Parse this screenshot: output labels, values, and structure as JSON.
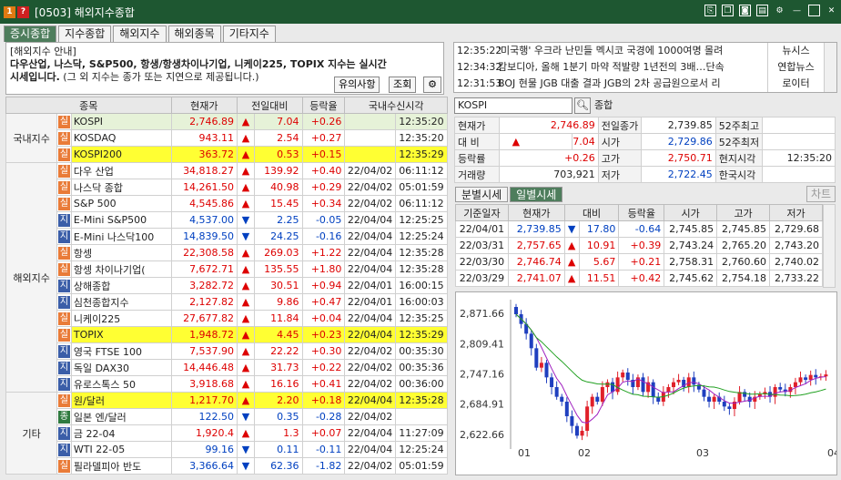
{
  "window": {
    "badge1": "1",
    "badge2": "?",
    "title": "[0503] 해외지수종합"
  },
  "tabs": [
    "증시종합",
    "지수종합",
    "해외지수",
    "해외종목",
    "기타지수"
  ],
  "notice": {
    "line1": "[해외지수 안내]",
    "line2": "다우산업, 나스닥, S&P500, 항생/항생차이나기업, 니케이225, TOPIX 지수는 실시간",
    "line3a": "시세입니다.",
    "line3b": "(그 외 지수는 종가 또는 지연으로 제공됩니다.)",
    "btn_caution": "유의사항",
    "btn_query": "조회"
  },
  "list_headers": [
    "종목",
    "현재가",
    "전일대비",
    "등락율",
    "국내수신시각"
  ],
  "groups": [
    {
      "label": "국내지수",
      "rows": [
        {
          "tag": "실",
          "name": "KOSPI",
          "price": "2,746.89",
          "dir": "▲",
          "chg": "7.04",
          "rate": "+0.26",
          "date": "",
          "time": "12:35:20",
          "hl": "grn"
        },
        {
          "tag": "실",
          "name": "KOSDAQ",
          "price": "943.11",
          "dir": "▲",
          "chg": "2.54",
          "rate": "+0.27",
          "date": "",
          "time": "12:35:20",
          "hl": ""
        },
        {
          "tag": "실",
          "name": "KOSPI200",
          "price": "363.72",
          "dir": "▲",
          "chg": "0.53",
          "rate": "+0.15",
          "date": "",
          "time": "12:35:29",
          "hl": "yel"
        }
      ]
    },
    {
      "label": "해외지수",
      "rows": [
        {
          "tag": "실",
          "name": "다우 산업",
          "price": "34,818.27",
          "dir": "▲",
          "chg": "139.92",
          "rate": "+0.40",
          "date": "22/04/02",
          "time": "06:11:12",
          "hl": ""
        },
        {
          "tag": "실",
          "name": "나스닥 종합",
          "price": "14,261.50",
          "dir": "▲",
          "chg": "40.98",
          "rate": "+0.29",
          "date": "22/04/02",
          "time": "05:01:59",
          "hl": ""
        },
        {
          "tag": "실",
          "name": "S&P 500",
          "price": "4,545.86",
          "dir": "▲",
          "chg": "15.45",
          "rate": "+0.34",
          "date": "22/04/02",
          "time": "06:11:12",
          "hl": ""
        },
        {
          "tag": "지",
          "name": "E-Mini S&P500",
          "price": "4,537.00",
          "dir": "▼",
          "chg": "2.25",
          "rate": "-0.05",
          "date": "22/04/04",
          "time": "12:25:25",
          "hl": ""
        },
        {
          "tag": "지",
          "name": "E-Mini 나스닥100",
          "price": "14,839.50",
          "dir": "▼",
          "chg": "24.25",
          "rate": "-0.16",
          "date": "22/04/04",
          "time": "12:25:24",
          "hl": ""
        },
        {
          "tag": "실",
          "name": "항셍",
          "price": "22,308.58",
          "dir": "▲",
          "chg": "269.03",
          "rate": "+1.22",
          "date": "22/04/04",
          "time": "12:35:28",
          "hl": ""
        },
        {
          "tag": "실",
          "name": "항셍 차이나기업(",
          "price": "7,672.71",
          "dir": "▲",
          "chg": "135.55",
          "rate": "+1.80",
          "date": "22/04/04",
          "time": "12:35:28",
          "hl": ""
        },
        {
          "tag": "지",
          "name": "상해종합",
          "price": "3,282.72",
          "dir": "▲",
          "chg": "30.51",
          "rate": "+0.94",
          "date": "22/04/01",
          "time": "16:00:15",
          "hl": ""
        },
        {
          "tag": "지",
          "name": "심천종합지수",
          "price": "2,127.82",
          "dir": "▲",
          "chg": "9.86",
          "rate": "+0.47",
          "date": "22/04/01",
          "time": "16:00:03",
          "hl": ""
        },
        {
          "tag": "실",
          "name": "니케이225",
          "price": "27,677.82",
          "dir": "▲",
          "chg": "11.84",
          "rate": "+0.04",
          "date": "22/04/04",
          "time": "12:35:25",
          "hl": ""
        },
        {
          "tag": "실",
          "name": "TOPIX",
          "price": "1,948.72",
          "dir": "▲",
          "chg": "4.45",
          "rate": "+0.23",
          "date": "22/04/04",
          "time": "12:35:29",
          "hl": "yel"
        },
        {
          "tag": "지",
          "name": "영국 FTSE 100",
          "price": "7,537.90",
          "dir": "▲",
          "chg": "22.22",
          "rate": "+0.30",
          "date": "22/04/02",
          "time": "00:35:30",
          "hl": ""
        },
        {
          "tag": "지",
          "name": "독일 DAX30",
          "price": "14,446.48",
          "dir": "▲",
          "chg": "31.73",
          "rate": "+0.22",
          "date": "22/04/02",
          "time": "00:35:36",
          "hl": ""
        },
        {
          "tag": "지",
          "name": "유로스톡스 50",
          "price": "3,918.68",
          "dir": "▲",
          "chg": "16.16",
          "rate": "+0.41",
          "date": "22/04/02",
          "time": "00:36:00",
          "hl": ""
        }
      ]
    },
    {
      "label": "기타",
      "rows": [
        {
          "tag": "실",
          "name": "원/달러",
          "price": "1,217.70",
          "dir": "▲",
          "chg": "2.20",
          "rate": "+0.18",
          "date": "22/04/04",
          "time": "12:35:28",
          "hl": "yel"
        },
        {
          "tag": "종",
          "name": "일본 엔/달러",
          "price": "122.50",
          "dir": "▼",
          "chg": "0.35",
          "rate": "-0.28",
          "date": "22/04/02",
          "time": "",
          "hl": ""
        },
        {
          "tag": "지",
          "name": "금 22-04",
          "price": "1,920.4",
          "dir": "▲",
          "chg": "1.3",
          "rate": "+0.07",
          "date": "22/04/04",
          "time": "11:27:09",
          "hl": ""
        },
        {
          "tag": "지",
          "name": "WTI 22-05",
          "price": "99.16",
          "dir": "▼",
          "chg": "0.11",
          "rate": "-0.11",
          "date": "22/04/04",
          "time": "12:25:24",
          "hl": ""
        },
        {
          "tag": "실",
          "name": "필라델피아 반도",
          "price": "3,366.64",
          "dir": "▼",
          "chg": "62.36",
          "rate": "-1.82",
          "date": "22/04/02",
          "time": "05:01:59",
          "hl": ""
        }
      ]
    }
  ],
  "news": [
    {
      "time": "12:35:22",
      "head": "'미국행' 우크라 난민들 멕시코 국경에 1000여명 몰려",
      "src": "뉴시스"
    },
    {
      "time": "12:34:32",
      "head": "캄보디아, 올해 1분기 마약 적발량 1년전의 3배…단속",
      "src": "연합뉴스"
    },
    {
      "time": "12:31:53",
      "head": "BOJ 현물 JGB 대출 결과 JGB의 2차 공급원으로서 리",
      "src": "로이터"
    }
  ],
  "search": {
    "value": "KOSPI",
    "name": "종합"
  },
  "quote": {
    "r1": [
      "현재가",
      "2,746.89",
      "전일종가",
      "2,739.85",
      "52주최고",
      ""
    ],
    "r2": [
      "대 비",
      "▲",
      "7.04",
      "시가",
      "2,729.86",
      "52주최저",
      ""
    ],
    "r3": [
      "등락률",
      "+0.26",
      "고가",
      "2,750.71",
      "현지시각",
      "12:35:20"
    ],
    "r4": [
      "거래량",
      "703,921",
      "저가",
      "2,722.45",
      "한국시각",
      ""
    ]
  },
  "sub_tabs": [
    "분별시세",
    "일별시세"
  ],
  "chart_btn": "차트",
  "daily_headers": [
    "기준일자",
    "현재가",
    "대비",
    "등락율",
    "시가",
    "고가",
    "저가"
  ],
  "daily_rows": [
    [
      "22/04/01",
      "2,739.85",
      "▼",
      "17.80",
      "-0.64",
      "2,745.85",
      "2,745.85",
      "2,729.68"
    ],
    [
      "22/03/31",
      "2,757.65",
      "▲",
      "10.91",
      "+0.39",
      "2,743.24",
      "2,765.20",
      "2,743.20"
    ],
    [
      "22/03/30",
      "2,746.74",
      "▲",
      "5.67",
      "+0.21",
      "2,758.31",
      "2,760.60",
      "2,740.02"
    ],
    [
      "22/03/29",
      "2,741.07",
      "▲",
      "11.51",
      "+0.42",
      "2,745.62",
      "2,754.18",
      "2,733.22"
    ]
  ],
  "chart_data": {
    "type": "candlestick",
    "y_ticks": [
      "2,871.66",
      "2,809.41",
      "2,747.16",
      "2,684.91",
      "2,622.66"
    ],
    "y_values": [
      2871.66,
      2809.41,
      2747.16,
      2684.91,
      2622.66
    ],
    "x_ticks": [
      "01",
      "02",
      "03",
      "04"
    ],
    "colors": {
      "up": "#e0202a",
      "down": "#1f3fbf",
      "ma5": "#a020c0",
      "ma20": "#20a020"
    }
  }
}
